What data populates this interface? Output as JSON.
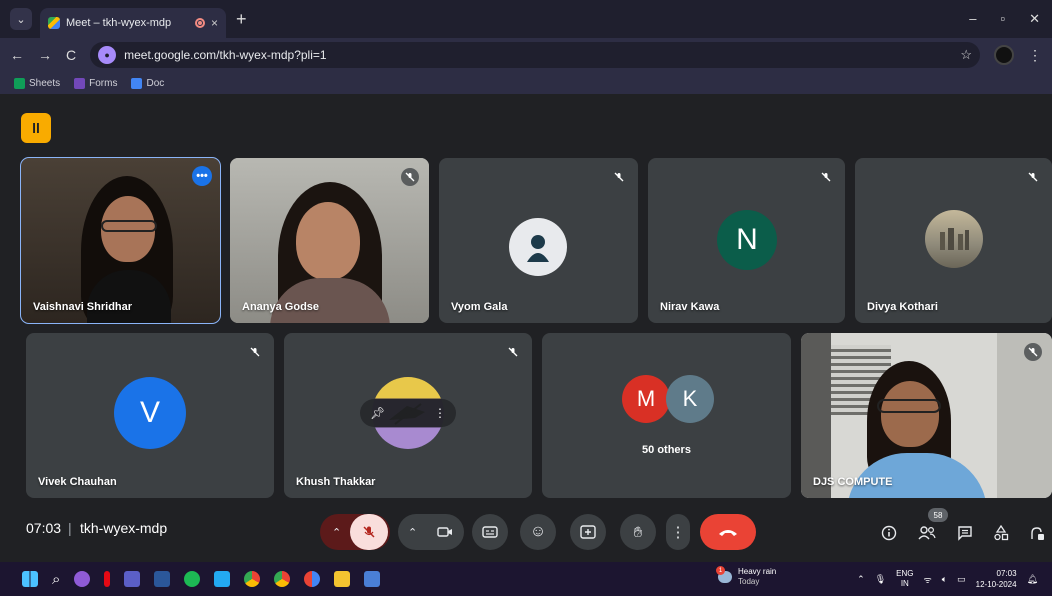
{
  "browser": {
    "tab_title": "Meet – tkh-wyex-mdp",
    "tab_close": "×",
    "new_tab": "+",
    "minimize": "–",
    "restore": "▫",
    "close": "✕",
    "back": "←",
    "forward": "→",
    "reload": "C",
    "url": "meet.google.com/tkh-wyex-mdp?pli=1",
    "bookmarks": [
      {
        "label": "Sheets",
        "color": "#0f9d58"
      },
      {
        "label": "Forms",
        "color": "#7248b9"
      },
      {
        "label": "Doc",
        "color": "#4285f4"
      }
    ]
  },
  "meet": {
    "participants": [
      {
        "name": "Vaishnavi Shridhar"
      },
      {
        "name": "Ananya Godse"
      },
      {
        "name": "Vyom Gala"
      },
      {
        "name": "Nirav Kawa",
        "initial": "N",
        "color": "#0b5d4a"
      },
      {
        "name": "Divya Kothari"
      },
      {
        "name": "Vivek Chauhan",
        "initial": "V",
        "color": "#1a73e8"
      },
      {
        "name": "Khush Thakkar"
      },
      {
        "name": "DJS COMPUTE"
      }
    ],
    "others": {
      "label": "50 others",
      "avatars": [
        {
          "initial": "M",
          "color": "#d93025"
        },
        {
          "initial": "K",
          "color": "#5f7b8a"
        }
      ]
    }
  },
  "bottom_bar": {
    "time": "07:03",
    "separator": "|",
    "meeting_code": "tkh-wyex-mdp",
    "participants_count": "58"
  },
  "taskbar": {
    "weather_title": "Heavy rain",
    "weather_sub": "Today",
    "weather_badge": "1",
    "lang_top": "ENG",
    "lang_bottom": "IN",
    "time": "07:03",
    "date": "12-10-2024"
  }
}
